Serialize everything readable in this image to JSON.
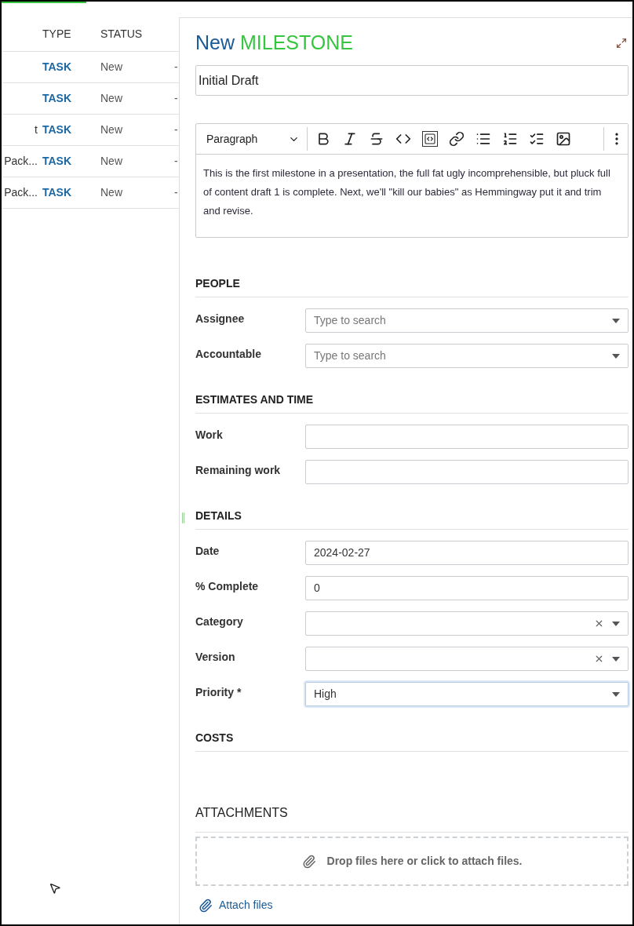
{
  "table": {
    "columns": [
      "TYPE",
      "STATUS"
    ],
    "rows": [
      {
        "column_1": "",
        "type": "TASK",
        "status": "New",
        "column_4": "-"
      },
      {
        "column_1": "",
        "type": "TASK",
        "status": "New",
        "column_4": "-"
      },
      {
        "column_1": "t",
        "type": "TASK",
        "status": "New",
        "column_4": "-"
      },
      {
        "column_1": "Pack...",
        "type": "TASK",
        "status": "New",
        "column_4": "-"
      },
      {
        "column_1": "Pack...",
        "type": "TASK",
        "status": "New",
        "column_4": "-"
      }
    ]
  },
  "panel": {
    "title_prefix": "New",
    "title_type": "MILESTONE",
    "subject": "Initial Draft",
    "editor": {
      "format": "Paragraph",
      "tools": [
        {
          "kind": "bold",
          "selected": false
        },
        {
          "kind": "italic",
          "selected": false
        },
        {
          "kind": "strike",
          "selected": false
        },
        {
          "kind": "code",
          "selected": false
        },
        {
          "kind": "codeblock",
          "selected": true
        },
        {
          "kind": "link",
          "selected": false
        },
        {
          "kind": "bullets",
          "selected": false
        },
        {
          "kind": "numbers",
          "selected": false
        },
        {
          "kind": "todo",
          "selected": false
        },
        {
          "kind": "image",
          "selected": false
        }
      ],
      "text": "This is the first milestone in a presentation, the full fat ugly incomprehensible, but pluck full of content draft 1 is complete.  Next, we'll \"kill our babies\" as Hemmingway put it and trim and revise."
    },
    "sections": [
      {
        "title": "PEOPLE",
        "fields": [
          {
            "label": "Assignee",
            "kind": "select",
            "placeholder": "Type to search"
          },
          {
            "label": "Accountable",
            "kind": "select",
            "placeholder": "Type to search"
          }
        ]
      },
      {
        "title": "ESTIMATES AND TIME",
        "fields": [
          {
            "label": "Work",
            "kind": "text"
          },
          {
            "label": "Remaining work",
            "kind": "text"
          }
        ]
      },
      {
        "title": "DETAILS",
        "fields": [
          {
            "label": "Date",
            "kind": "text",
            "value": "2024-02-27"
          },
          {
            "label": "% Complete",
            "kind": "text",
            "value": "0"
          },
          {
            "label": "Category",
            "kind": "clearable"
          },
          {
            "label": "Version",
            "kind": "clearable"
          },
          {
            "label": "Priority *",
            "kind": "select",
            "value": "High",
            "focused": true
          }
        ]
      },
      {
        "title": "COSTS"
      }
    ],
    "attachments": {
      "title": "ATTACHMENTS",
      "drop_text": "Drop files here or click to attach files.",
      "link": "Attach files"
    }
  }
}
